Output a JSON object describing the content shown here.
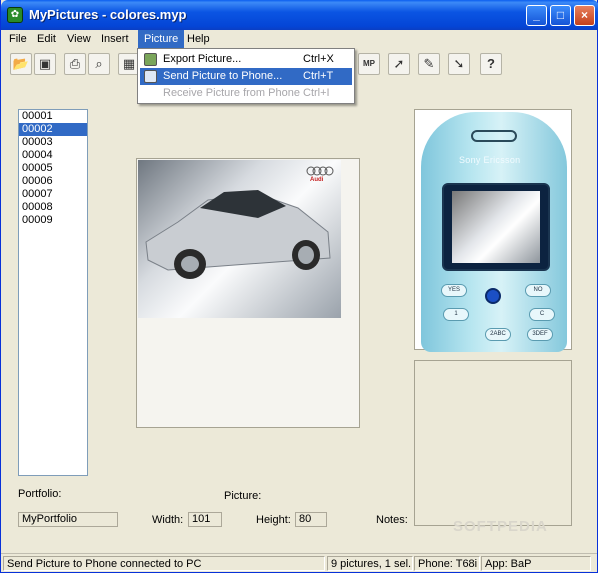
{
  "window": {
    "title": "MyPictures - colores.myp",
    "app_icon": "pictures-icon",
    "minimize_glyph": "_",
    "maximize_glyph": "□",
    "close_glyph": "×"
  },
  "menu": {
    "file": "File",
    "edit": "Edit",
    "view": "View",
    "insert": "Insert",
    "picture": "Picture",
    "help": "Help"
  },
  "dropdown": {
    "items": [
      {
        "label": "Export Picture...",
        "shortcut": "Ctrl+X",
        "enabled": true,
        "selected": false
      },
      {
        "label": "Send Picture to Phone...",
        "shortcut": "Ctrl+T",
        "enabled": true,
        "selected": true
      },
      {
        "label": "Receive Picture from Phone",
        "shortcut": "Ctrl+I",
        "enabled": false,
        "selected": false
      }
    ]
  },
  "toolbar": {
    "mp_label": "MP",
    "help_glyph": "?"
  },
  "list": {
    "items": [
      "00001",
      "00002",
      "00003",
      "00004",
      "00005",
      "00006",
      "00007",
      "00008",
      "00009"
    ],
    "selected": "00002"
  },
  "phone": {
    "brand": "Sony Ericsson",
    "keys": [
      "YES",
      "NO",
      "1",
      "C",
      "2ABC",
      "3DEF"
    ]
  },
  "labels": {
    "portfolio": "Portfolio:",
    "picture": "Picture:",
    "width": "Width:",
    "height": "Height:",
    "notes": "Notes:"
  },
  "fields": {
    "portfolio": "MyPortfolio",
    "width": "101",
    "height": "80"
  },
  "status": {
    "message": "Send Picture to Phone connected to PC",
    "count": "9 pictures, 1 sel.",
    "phone": "Phone: T68i",
    "app": "App: BaP"
  },
  "watermark": "SOFTPEDIA",
  "car_badge": "Audi"
}
